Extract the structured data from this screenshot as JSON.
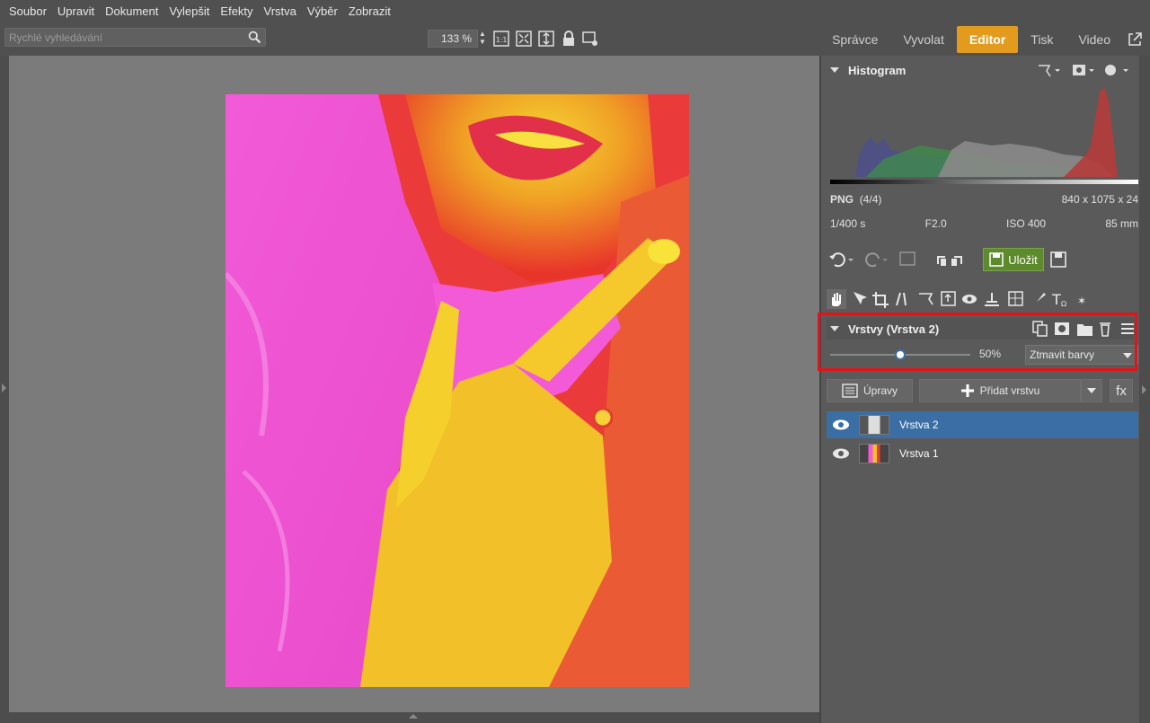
{
  "menu": [
    "Soubor",
    "Upravit",
    "Dokument",
    "Vylepšit",
    "Efekty",
    "Vrstva",
    "Výběr",
    "Zobrazit"
  ],
  "search": {
    "placeholder": "Rychlé vyhledávání"
  },
  "zoom": {
    "value": "133 %"
  },
  "module_tabs": [
    "Správce",
    "Vyvolat",
    "Editor",
    "Tisk",
    "Video"
  ],
  "active_tab": "Editor",
  "histogram": {
    "title": "Histogram"
  },
  "file_info": {
    "format": "PNG",
    "index": "(4/4)",
    "dimensions": "840 x 1075 x 24",
    "shutter": "1/400 s",
    "aperture": "F2.0",
    "iso": "ISO 400",
    "focal": "85 mm"
  },
  "save_label": "Uložit",
  "layers": {
    "title": "Vrstvy (Vrstva 2)",
    "opacity": 0.5,
    "opacity_label": "50%",
    "blend_mode": "Ztmavit barvy",
    "adjust_label": "Úpravy",
    "add_layer_label": "Přidat vrstvu",
    "fx_label": "fx",
    "items": [
      {
        "name": "Vrstva 2",
        "selected": true
      },
      {
        "name": "Vrstva 1",
        "selected": false
      }
    ]
  },
  "colors": {
    "accent": "#e39b1d",
    "selection": "#3a6ea5",
    "highlight_box": "#e0151b",
    "save": "#5e8a2e"
  }
}
